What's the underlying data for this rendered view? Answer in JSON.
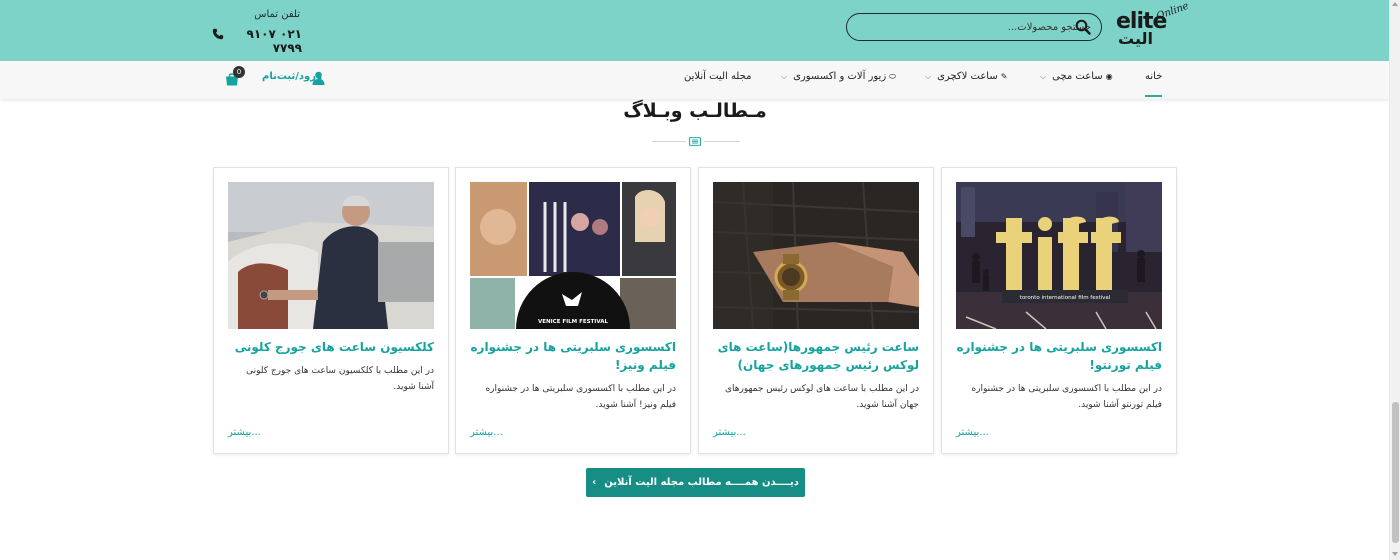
{
  "header": {
    "logo_en": "elite",
    "logo_fa": "الیت",
    "logo_sup": "Online",
    "search_placeholder": "جستجو محصولات...",
    "contact_label": "تلفن تماس",
    "phone": "۰۲۱ ۹۱۰۷ ۷۷۹۹"
  },
  "nav": {
    "items": [
      {
        "label": "خانه"
      },
      {
        "label": "ساعت مچی"
      },
      {
        "label": "ساعت لاکچری"
      },
      {
        "label": "زیور آلات و اکسسوری"
      },
      {
        "label": "مجله الیت آنلاین"
      }
    ],
    "login": "ورود/ثبت‌نام",
    "cart_count": "0"
  },
  "section": {
    "title": "مـطالـب وبـلاگ"
  },
  "cards": [
    {
      "title": "اکسسوری سلبریتی ها در جشنواره فیلم تورنتو!",
      "desc": "در این مطلب با اکسسوری سلبریتی ها در جشنواره فیلم تورنتو آشنا شوید.",
      "more": "بیشتر...",
      "image_text": "toronto international film festival"
    },
    {
      "title": "ساعت رئیس جمهورها(ساعت های لوکس رئیس جمهورهای جهان)",
      "desc": "در این مطلب با ساعت های لوکس رئیس جمهورهای جهان آشنا شوید.",
      "more": "بیشتر..."
    },
    {
      "title": "اکسسوری سلبریتی ها در جشنواره فیلم ونیز!",
      "desc": "در این مطلب با اکسسوری سلبریتی ها در جشنواره فیلم ونیز! آشنا شوید.",
      "more": "بیشتر...",
      "image_text": "VENICE FILM FESTIVAL"
    },
    {
      "title": "کلکسیون ساعت های جورج کلونی",
      "desc": "در این مطلب با کلکسیون ساعت های جورج کلونی آشنا شوید.",
      "more": "بیشتر..."
    }
  ],
  "all_posts_button": "دیــــدن همــــه مطالب مجله الیت آنلاین",
  "colors": {
    "header_bg": "#7ed3c9",
    "accent": "#14a39f",
    "button_bg": "#168e86"
  }
}
